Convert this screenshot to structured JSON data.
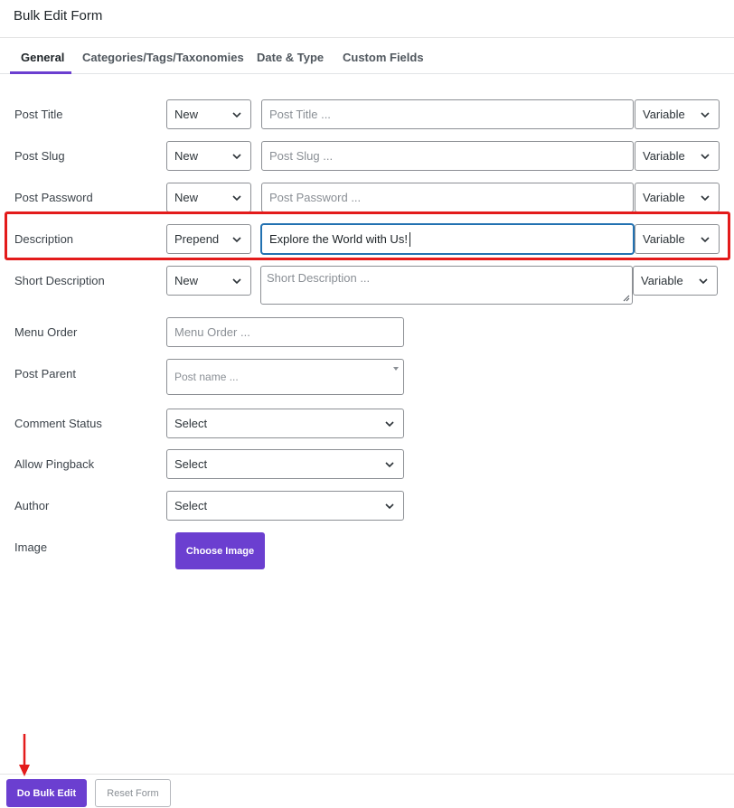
{
  "header": {
    "title": "Bulk Edit Form"
  },
  "tabs": [
    {
      "label": "General",
      "active": true
    },
    {
      "label": "Categories/Tags/Taxonomies",
      "active": false
    },
    {
      "label": "Date & Type",
      "active": false
    },
    {
      "label": "Custom Fields",
      "active": false
    }
  ],
  "rows": {
    "post_title": {
      "label": "Post Title",
      "mode": "New",
      "placeholder": "Post Title ...",
      "variable": "Variable"
    },
    "post_slug": {
      "label": "Post Slug",
      "mode": "New",
      "placeholder": "Post Slug ...",
      "variable": "Variable"
    },
    "post_password": {
      "label": "Post Password",
      "mode": "New",
      "placeholder": "Post Password ...",
      "variable": "Variable"
    },
    "description": {
      "label": "Description",
      "mode": "Prepend",
      "value": "Explore the World with Us!",
      "variable": "Variable"
    },
    "short_description": {
      "label": "Short Description",
      "mode": "New",
      "placeholder": "Short Description ...",
      "variable": "Variable"
    },
    "menu_order": {
      "label": "Menu Order",
      "placeholder": "Menu Order ..."
    },
    "post_parent": {
      "label": "Post Parent",
      "placeholder": "Post name ..."
    },
    "comment_status": {
      "label": "Comment Status",
      "value": "Select"
    },
    "allow_pingback": {
      "label": "Allow Pingback",
      "value": "Select"
    },
    "author": {
      "label": "Author",
      "value": "Select"
    },
    "image": {
      "label": "Image",
      "button": "Choose Image"
    }
  },
  "footer": {
    "primary": "Do Bulk Edit",
    "secondary": "Reset Form"
  },
  "colors": {
    "accent": "#6b3fd0",
    "highlight": "#e31b1b"
  }
}
